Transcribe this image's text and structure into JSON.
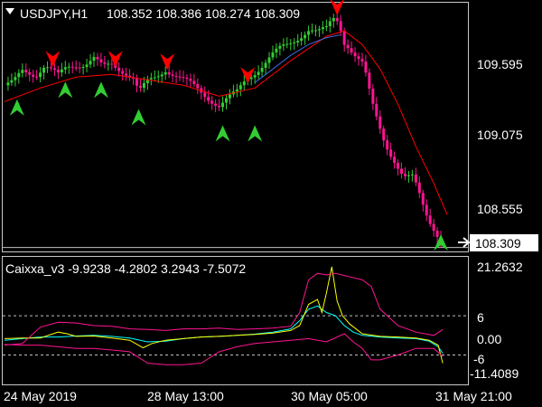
{
  "colors": {
    "background": "#000000",
    "frame": "#c8c8c8",
    "text": "#ffffff",
    "bull_candle": "#32cd32",
    "bear_candle": "#ff1493",
    "slow_ma": "#ff0000",
    "fast_ma": "#4169e1",
    "buy_arrow": "#32cd32",
    "sell_arrow": "#ff0000",
    "price_line": "#c0c0c0",
    "upper_band": "#ff1493",
    "lower_band": "#ff1493",
    "osc_line": "#00ffff",
    "osc_signal": "#ffff00",
    "level_line": "#c0c0c0"
  },
  "header": {
    "collapse_icon": "triangle-down-icon",
    "symbol": "USDJPY,H1",
    "ohlc": "108.352 108.386 108.274 108.309"
  },
  "indicator": {
    "title": "Caixxa_v3 -9.9238 -4.2802 3.2943 -7.5072"
  },
  "chart_data": [
    {
      "type": "candlestick",
      "series_name": "USDJPY,H1",
      "y_ticks": [
        "109.595",
        "109.075",
        "108.555"
      ],
      "current_price_label": "108.309",
      "ylim": [
        108.28,
        110.1
      ],
      "x_ticks": [
        "24 May 2019",
        "28 May 13:00",
        "30 May 05:00",
        "31 May 21:00"
      ],
      "close_path": [
        [
          0,
          109.5
        ],
        [
          10,
          109.52
        ],
        [
          20,
          109.6
        ],
        [
          35,
          109.58
        ],
        [
          45,
          109.65
        ],
        [
          55,
          109.6
        ],
        [
          60,
          109.57
        ],
        [
          70,
          109.63
        ],
        [
          80,
          109.65
        ],
        [
          90,
          109.66
        ],
        [
          100,
          109.7
        ],
        [
          110,
          109.63
        ],
        [
          120,
          109.65
        ],
        [
          135,
          109.6
        ],
        [
          145,
          109.55
        ],
        [
          150,
          109.45
        ],
        [
          160,
          109.52
        ],
        [
          170,
          109.56
        ],
        [
          180,
          109.62
        ],
        [
          190,
          109.58
        ],
        [
          200,
          109.54
        ],
        [
          210,
          109.5
        ],
        [
          220,
          109.45
        ],
        [
          230,
          109.4
        ],
        [
          240,
          109.35
        ],
        [
          250,
          109.4
        ],
        [
          260,
          109.45
        ],
        [
          270,
          109.55
        ],
        [
          280,
          109.6
        ],
        [
          290,
          109.65
        ],
        [
          300,
          109.72
        ],
        [
          310,
          109.78
        ],
        [
          320,
          109.82
        ],
        [
          330,
          109.86
        ],
        [
          340,
          109.9
        ],
        [
          350,
          109.88
        ],
        [
          360,
          109.92
        ],
        [
          365,
          109.98
        ],
        [
          370,
          110.02
        ],
        [
          375,
          109.95
        ],
        [
          380,
          109.82
        ],
        [
          385,
          109.78
        ],
        [
          390,
          109.72
        ],
        [
          395,
          109.68
        ],
        [
          400,
          109.65
        ],
        [
          405,
          109.55
        ],
        [
          410,
          109.4
        ],
        [
          415,
          109.3
        ],
        [
          420,
          109.2
        ],
        [
          425,
          109.1
        ],
        [
          430,
          109.02
        ],
        [
          435,
          108.95
        ],
        [
          440,
          108.88
        ],
        [
          445,
          108.82
        ],
        [
          450,
          108.8
        ],
        [
          455,
          108.84
        ],
        [
          460,
          108.78
        ],
        [
          465,
          108.7
        ],
        [
          470,
          108.6
        ],
        [
          475,
          108.52
        ],
        [
          480,
          108.45
        ],
        [
          485,
          108.38
        ],
        [
          490,
          108.31
        ]
      ],
      "slow_ma": [
        [
          0,
          109.38
        ],
        [
          40,
          109.48
        ],
        [
          80,
          109.56
        ],
        [
          120,
          109.58
        ],
        [
          160,
          109.54
        ],
        [
          200,
          109.5
        ],
        [
          240,
          109.42
        ],
        [
          280,
          109.48
        ],
        [
          320,
          109.68
        ],
        [
          360,
          109.86
        ],
        [
          380,
          109.9
        ],
        [
          400,
          109.8
        ],
        [
          420,
          109.62
        ],
        [
          440,
          109.36
        ],
        [
          460,
          109.05
        ],
        [
          480,
          108.78
        ],
        [
          495,
          108.55
        ]
      ],
      "fast_ma": [
        [
          280,
          109.52
        ],
        [
          300,
          109.62
        ],
        [
          320,
          109.72
        ],
        [
          340,
          109.8
        ],
        [
          360,
          109.85
        ],
        [
          375,
          109.87
        ]
      ],
      "buy_signals": [
        [
          14,
          109.33
        ],
        [
          68,
          109.46
        ],
        [
          108,
          109.46
        ],
        [
          150,
          109.26
        ],
        [
          244,
          109.14
        ],
        [
          280,
          109.14
        ],
        [
          488,
          108.34
        ]
      ],
      "sell_signals": [
        [
          54,
          109.7
        ],
        [
          124,
          109.7
        ],
        [
          182,
          109.68
        ],
        [
          272,
          109.58
        ],
        [
          372,
          110.08
        ]
      ]
    },
    {
      "type": "line",
      "y_ticks": [
        "21.2632",
        "6",
        "0.00",
        "-6",
        "-11.4089"
      ],
      "ylim": [
        -11.4089,
        21.2632
      ],
      "levels": [
        6,
        -6
      ],
      "series": [
        {
          "values": [
            [
              0,
              -1.5
            ],
            [
              20,
              -1.0
            ],
            [
              40,
              -0.5
            ],
            [
              60,
              -0.5
            ],
            [
              80,
              -0.2
            ],
            [
              100,
              0.0
            ],
            [
              120,
              -0.3
            ],
            [
              140,
              -0.8
            ],
            [
              160,
              -2.0
            ],
            [
              180,
              -1.8
            ],
            [
              200,
              -1.0
            ],
            [
              220,
              -0.5
            ],
            [
              240,
              -0.3
            ],
            [
              260,
              0.0
            ],
            [
              280,
              0.4
            ],
            [
              300,
              1.0
            ],
            [
              320,
              2.0
            ],
            [
              330,
              4.5
            ],
            [
              340,
              8.0
            ],
            [
              350,
              9.0
            ],
            [
              360,
              7.0
            ],
            [
              370,
              6.0
            ],
            [
              380,
              3.0
            ],
            [
              390,
              1.0
            ],
            [
              400,
              0.0
            ],
            [
              420,
              -0.5
            ],
            [
              440,
              -0.8
            ],
            [
              460,
              -1.0
            ],
            [
              475,
              -1.8
            ],
            [
              485,
              -3.5
            ],
            [
              490,
              -5.5
            ]
          ]
        },
        {
          "values": [
            [
              0,
              -1.0
            ],
            [
              20,
              -0.8
            ],
            [
              40,
              -0.8
            ],
            [
              60,
              1.0
            ],
            [
              70,
              0.5
            ],
            [
              80,
              -0.3
            ],
            [
              100,
              -0.2
            ],
            [
              120,
              -0.8
            ],
            [
              140,
              -1.5
            ],
            [
              155,
              -3.8
            ],
            [
              165,
              -2.5
            ],
            [
              180,
              -1.5
            ],
            [
              200,
              -1.0
            ],
            [
              220,
              -0.5
            ],
            [
              240,
              -0.3
            ],
            [
              260,
              0.0
            ],
            [
              280,
              0.3
            ],
            [
              300,
              0.7
            ],
            [
              320,
              1.5
            ],
            [
              330,
              3.0
            ],
            [
              340,
              9.5
            ],
            [
              350,
              11.0
            ],
            [
              355,
              7.0
            ],
            [
              360,
              13.0
            ],
            [
              366,
              21.0
            ],
            [
              372,
              10.5
            ],
            [
              378,
              6.0
            ],
            [
              386,
              3.5
            ],
            [
              400,
              0.5
            ],
            [
              420,
              -0.3
            ],
            [
              440,
              -0.5
            ],
            [
              460,
              -0.8
            ],
            [
              475,
              -1.5
            ],
            [
              485,
              -3.0
            ],
            [
              490,
              -8.5
            ]
          ]
        },
        {
          "values": [
            [
              0,
              -3.0
            ],
            [
              20,
              -2.5
            ],
            [
              40,
              2.5
            ],
            [
              60,
              4.0
            ],
            [
              80,
              3.8
            ],
            [
              100,
              3.0
            ],
            [
              120,
              2.8
            ],
            [
              140,
              2.0
            ],
            [
              160,
              1.8
            ],
            [
              180,
              1.5
            ],
            [
              200,
              2.0
            ],
            [
              220,
              2.0
            ],
            [
              240,
              2.2
            ],
            [
              260,
              1.8
            ],
            [
              280,
              2.0
            ],
            [
              300,
              2.2
            ],
            [
              320,
              2.8
            ],
            [
              330,
              7.0
            ],
            [
              340,
              17.0
            ],
            [
              350,
              19.0
            ],
            [
              360,
              18.5
            ],
            [
              370,
              19.0
            ],
            [
              385,
              18.0
            ],
            [
              400,
              17.0
            ],
            [
              410,
              15.0
            ],
            [
              420,
              8.0
            ],
            [
              440,
              3.0
            ],
            [
              460,
              1.0
            ],
            [
              480,
              0.0
            ],
            [
              490,
              1.8
            ]
          ]
        },
        {
          "values": [
            [
              0,
              -2.8
            ],
            [
              20,
              -3.0
            ],
            [
              40,
              -3.0
            ],
            [
              60,
              -3.5
            ],
            [
              80,
              -4.0
            ],
            [
              100,
              -4.0
            ],
            [
              120,
              -4.5
            ],
            [
              140,
              -5.0
            ],
            [
              160,
              -8.5
            ],
            [
              180,
              -9.0
            ],
            [
              200,
              -9.0
            ],
            [
              220,
              -8.5
            ],
            [
              240,
              -5.0
            ],
            [
              260,
              -3.5
            ],
            [
              280,
              -2.5
            ],
            [
              300,
              -2.0
            ],
            [
              320,
              -1.5
            ],
            [
              340,
              -1.0
            ],
            [
              360,
              -2.0
            ],
            [
              380,
              0.5
            ],
            [
              390,
              -2.0
            ],
            [
              400,
              -4.0
            ],
            [
              410,
              -7.5
            ],
            [
              420,
              -7.5
            ],
            [
              440,
              -6.0
            ],
            [
              460,
              -4.0
            ],
            [
              480,
              -4.0
            ],
            [
              490,
              -6.5
            ]
          ]
        }
      ]
    }
  ]
}
